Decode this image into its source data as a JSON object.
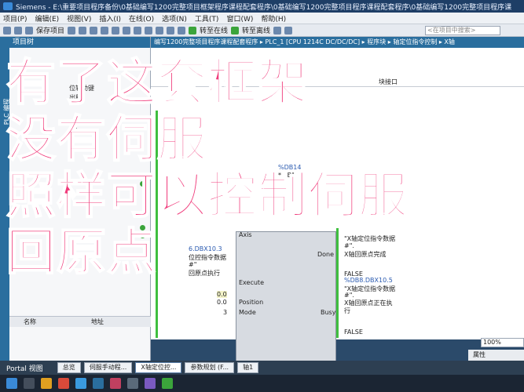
{
  "window": {
    "title": "Siemens - E:\\重要项目程序备份\\0基础编写1200完整项目框架程序课程配套程序\\0基础编写1200完整项目程序课程配套程序\\0基础编写1200完整项目程序课"
  },
  "menu": [
    "项目(P)",
    "编辑(E)",
    "视图(V)",
    "插入(I)",
    "在线(O)",
    "选项(N)",
    "工具(T)",
    "窗口(W)",
    "帮助(H)"
  ],
  "toolbar": {
    "save_label": "保存项目",
    "go_online": "转至在线",
    "go_offline": "转至离线",
    "search_placeholder": "<在项目中搜索>"
  },
  "left_panel": {
    "title": "项目树",
    "side_tab": "PLC 编程",
    "tree_items": [
      "位辅助键",
      "出程)",
      "序)"
    ],
    "columns": [
      "名称",
      "地址"
    ]
  },
  "breadcrumb": "编写1200完整项目程序课程配套程序 ▸ PLC_1 [CPU 1214C DC/DC/DC] ▸ 程序块 ▸ 轴定位指令控制 ▸ X轴",
  "editor": {
    "header_label": "块接口",
    "db_label": "%DB14",
    "db_sub": "*...B\"",
    "axis_pin": "Axis",
    "done_pin": "Done",
    "execute_pin": "Execute",
    "position_pin": "Position",
    "mode_pin": "Mode",
    "busy_pin": "Busy",
    "left_addr": "6.DBX10.3",
    "left_db": "位控指令数据",
    "left_sub": "#\"",
    "left_label": "回原点执行",
    "position_value": "0.0",
    "position_value2": "0.0",
    "mode_value": "3",
    "done_db": "\"X轴定位指令数据",
    "done_sub": "#\".",
    "done_out": "X轴回原点完成",
    "false1": "FALSE",
    "busy_addr": "%DB8.DBX10.5",
    "busy_db": "\"X轴定位指令数据",
    "busy_sub": "#\".",
    "busy_out1": "X轴回原点正在执",
    "busy_out2": "行",
    "false2": "FALSE"
  },
  "zoom": "100%",
  "properties": "属性",
  "portal": {
    "button": "Portal 视图",
    "tabs": [
      "总览",
      "伺服手动程...",
      "X轴定位控...",
      "参数规划 (F...",
      "轴1"
    ]
  },
  "overlay": {
    "line1": "有了这套框架",
    "line2": "没有伺服",
    "line3": "照样可以控制伺服",
    "line4": "回原点"
  },
  "colors": {
    "overlay_text": "#f03a7a",
    "accent_blue": "#2a6e9e",
    "online_green": "#3ba43b"
  }
}
